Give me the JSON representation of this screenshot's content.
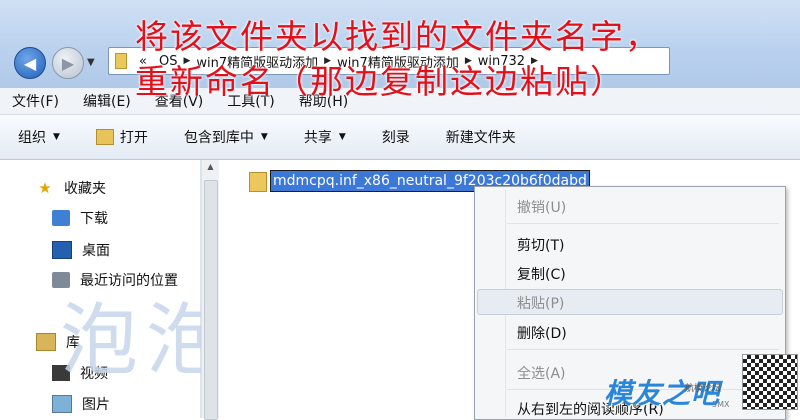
{
  "address": {
    "crumbs": [
      "OS",
      "win7精简版驱动添加",
      "win7精简版驱动添加",
      "win732"
    ],
    "overflow": "«"
  },
  "overlay": {
    "line1": "将该文件夹以找到的文件夹名字，",
    "line2": "重新命名（那边复制这边粘贴）"
  },
  "menubar": {
    "items": [
      "文件(F)",
      "编辑(E)",
      "查看(V)",
      "工具(T)",
      "帮助(H)"
    ]
  },
  "toolbar": {
    "organize": "组织",
    "open": "打开",
    "include": "包含到库中",
    "share": "共享",
    "burn": "刻录",
    "new_folder": "新建文件夹"
  },
  "sidebar": {
    "favorites": "收藏夹",
    "downloads": "下载",
    "desktop": "桌面",
    "recent": "最近访问的位置",
    "libraries": "库",
    "videos": "视频",
    "pictures": "图片"
  },
  "watermark": "泡泡",
  "file": {
    "name": "mdmcpq.inf_x86_neutral_9f203c20b6f0dabd"
  },
  "context_menu": {
    "undo": "撤销(U)",
    "cut": "剪切(T)",
    "copy": "复制(C)",
    "paste": "粘贴(P)",
    "delete": "删除(D)",
    "select_all": "全选(A)",
    "rtl": "从右到左的阅读顺序(R)"
  },
  "logo": {
    "text": "模友之吧",
    "sub": "航模论坛",
    "sub2": "5MX"
  }
}
